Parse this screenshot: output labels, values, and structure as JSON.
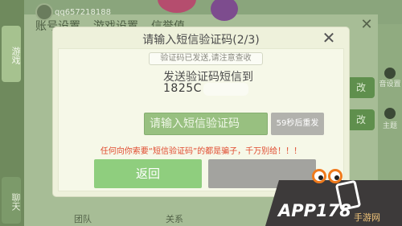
{
  "background": {
    "left_rail": {
      "tab_game": "游戏",
      "tab_chat": "聊天"
    },
    "user_id": "qq657218188",
    "top_tabs": [
      "账号设置",
      "游戏设置",
      "信誉值"
    ],
    "close_glyph": "✕",
    "right_col": {
      "item1": "音设置",
      "item2": "主题",
      "item3": "改"
    },
    "side_button_label": "改",
    "bottom_labels": [
      "团队",
      "关系"
    ]
  },
  "dialog": {
    "title": "请输入短信验证码(2/3)",
    "close_glyph": "✕",
    "notice": "验证码已发送,请注意查收",
    "send_to_label": "发送验证码短信到",
    "phone_number": "1825C",
    "code_input": {
      "placeholder": "请输入短信验证码",
      "value": ""
    },
    "resend_label": "59秒后重发",
    "warning": "任何向你索要“短信验证码”的都是骗子，千万别给！！！",
    "back_label": "返回",
    "confirm_label": ""
  },
  "watermark": {
    "main": "APP178",
    "sub": "手游网"
  },
  "colors": {
    "primary_green": "#8fce7e",
    "input_green": "#98c080",
    "disabled_gray": "#a3a39f",
    "warning_red": "#e04a2e"
  }
}
